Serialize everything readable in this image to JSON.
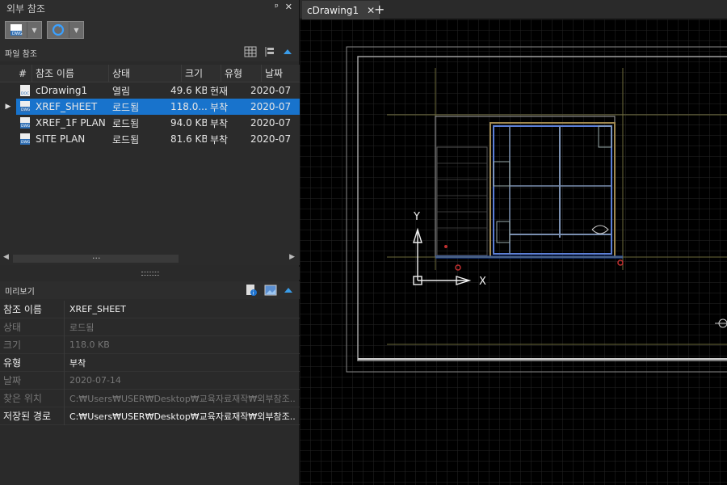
{
  "panel": {
    "title": "외부 참조",
    "pin_icon": "pin-icon",
    "close_icon": "close-icon"
  },
  "toolbar": {
    "attach_icon": "dwg-attach-icon",
    "refresh_icon": "refresh-icon"
  },
  "file_refs": {
    "header": "파일 참조",
    "columns": [
      "#",
      "참조 이름",
      "상태",
      "크기",
      "유형",
      "날짜"
    ],
    "rows": [
      {
        "name": "cDrawing1",
        "status": "열림",
        "size": "49.6 KB",
        "type": "현재",
        "date": "2020-07"
      },
      {
        "name": "XREF_SHEET",
        "status": "로드됨",
        "size": "118.0...",
        "type": "부착",
        "date": "2020-07"
      },
      {
        "name": "XREF_1F PLAN",
        "status": "로드됨",
        "size": "94.0 KB",
        "type": "부착",
        "date": "2020-07"
      },
      {
        "name": "SITE PLAN",
        "status": "로드됨",
        "size": "81.6 KB",
        "type": "부착",
        "date": "2020-07"
      }
    ],
    "scroll_dots": "..."
  },
  "preview": {
    "header": "미리보기",
    "props": [
      {
        "key": "참조 이름",
        "value": "XREF_SHEET"
      },
      {
        "key": "상태",
        "value": "로드됨"
      },
      {
        "key": "크기",
        "value": "118.0 KB"
      },
      {
        "key": "유형",
        "value": "부착"
      },
      {
        "key": "날짜",
        "value": "2020-07-14"
      },
      {
        "key": "찾은 위치",
        "value": "C:₩Users₩USER₩Desktop₩교육자료재작₩외부참조..."
      },
      {
        "key": "저장된 경로",
        "value": "C:₩Users₩USER₩Desktop₩교육자료재작₩외부참조..."
      }
    ]
  },
  "drawing_tab": {
    "label": "cDrawing1",
    "close": "✕",
    "add": "+"
  },
  "canvas": {
    "ucs_y": "Y",
    "ucs_x": "X",
    "background": "#000000",
    "grid_color": "#2a2a2a",
    "selection_color": "#1873cc"
  }
}
